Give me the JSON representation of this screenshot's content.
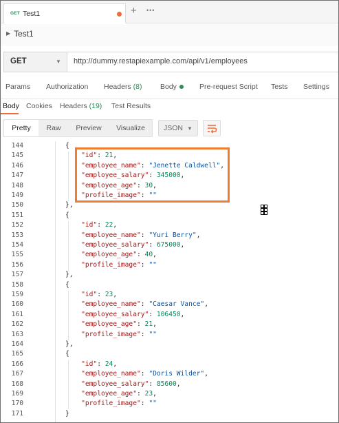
{
  "tab": {
    "method": "GET",
    "name": "Test1",
    "plus_icon": "plus-icon",
    "more_icon": "ellipsis-icon"
  },
  "request": {
    "name": "Test1"
  },
  "urlbar": {
    "method": "GET",
    "url": "http://dummy.restapiexample.com/api/v1/employees"
  },
  "request_tabs": [
    {
      "label": "Params"
    },
    {
      "label": "Authorization"
    },
    {
      "label": "Headers ",
      "count": "(8)"
    },
    {
      "label": "Body"
    },
    {
      "label": "Pre-request Script"
    },
    {
      "label": "Tests"
    },
    {
      "label": "Settings"
    }
  ],
  "response_tabs": [
    {
      "label": "Body"
    },
    {
      "label": "Cookies"
    },
    {
      "label": "Headers ",
      "count": "(19)"
    },
    {
      "label": "Test Results"
    }
  ],
  "format_buttons": [
    "Pretty",
    "Raw",
    "Preview",
    "Visualize"
  ],
  "format_select": "JSON",
  "colors": {
    "accent": "#f26b3a",
    "success": "#2e8b57",
    "highlight_box": "#ed7d31"
  },
  "code_lines": [
    {
      "n": "144",
      "t": "{"
    },
    {
      "n": "145",
      "t": "    \"id\": 21,"
    },
    {
      "n": "146",
      "t": "    \"employee_name\": \"Jenette Caldwell\","
    },
    {
      "n": "147",
      "t": "    \"employee_salary\": 345000,"
    },
    {
      "n": "148",
      "t": "    \"employee_age\": 30,"
    },
    {
      "n": "149",
      "t": "    \"profile_image\": \"\""
    },
    {
      "n": "150",
      "t": "},"
    },
    {
      "n": "151",
      "t": "{"
    },
    {
      "n": "152",
      "t": "    \"id\": 22,"
    },
    {
      "n": "153",
      "t": "    \"employee_name\": \"Yuri Berry\","
    },
    {
      "n": "154",
      "t": "    \"employee_salary\": 675000,"
    },
    {
      "n": "155",
      "t": "    \"employee_age\": 40,"
    },
    {
      "n": "156",
      "t": "    \"profile_image\": \"\""
    },
    {
      "n": "157",
      "t": "},"
    },
    {
      "n": "158",
      "t": "{"
    },
    {
      "n": "159",
      "t": "    \"id\": 23,"
    },
    {
      "n": "160",
      "t": "    \"employee_name\": \"Caesar Vance\","
    },
    {
      "n": "161",
      "t": "    \"employee_salary\": 106450,"
    },
    {
      "n": "162",
      "t": "    \"employee_age\": 21,"
    },
    {
      "n": "163",
      "t": "    \"profile_image\": \"\""
    },
    {
      "n": "164",
      "t": "},"
    },
    {
      "n": "165",
      "t": "{"
    },
    {
      "n": "166",
      "t": "    \"id\": 24,"
    },
    {
      "n": "167",
      "t": "    \"employee_name\": \"Doris Wilder\","
    },
    {
      "n": "168",
      "t": "    \"employee_salary\": 85600,"
    },
    {
      "n": "169",
      "t": "    \"employee_age\": 23,"
    },
    {
      "n": "170",
      "t": "    \"profile_image\": \"\""
    },
    {
      "n": "171",
      "t": "}"
    }
  ]
}
